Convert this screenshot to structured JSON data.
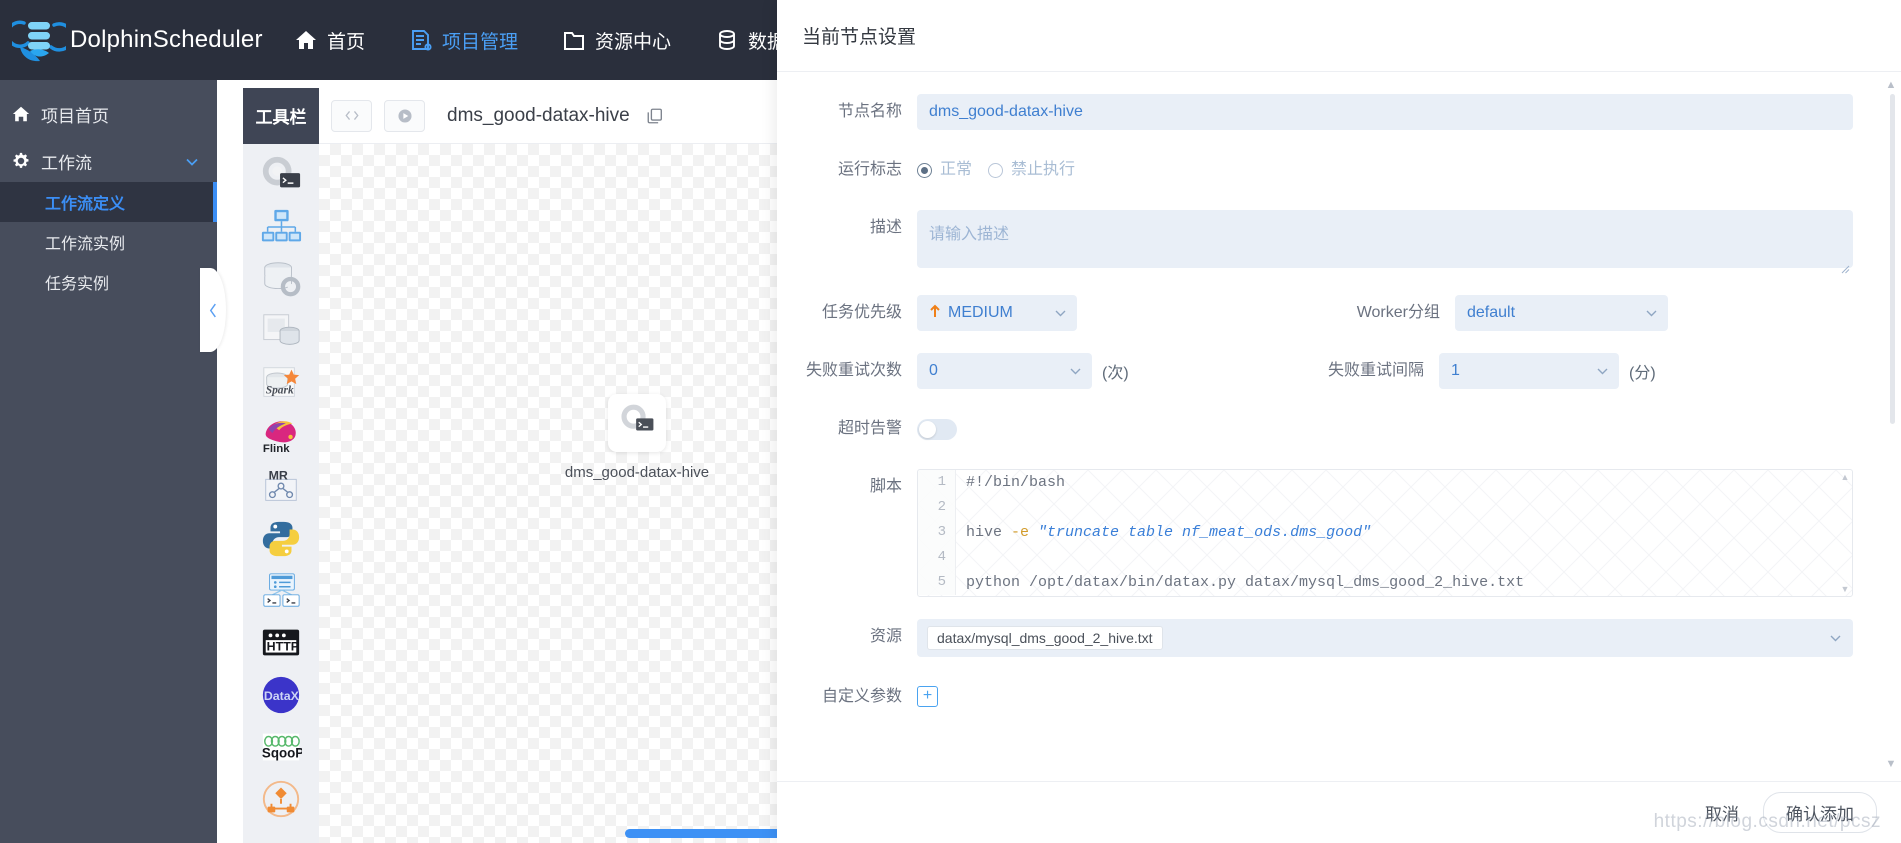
{
  "topnav": {
    "brand": "DolphinScheduler",
    "items": [
      {
        "label": "首页",
        "icon": "home-icon",
        "active": false
      },
      {
        "label": "项目管理",
        "icon": "project-icon",
        "active": true
      },
      {
        "label": "资源中心",
        "icon": "folder-icon",
        "active": false
      },
      {
        "label": "数据源中心",
        "icon": "database-icon",
        "active": false
      }
    ]
  },
  "sidebar": {
    "items": [
      {
        "label": "项目首页",
        "icon": "home-icon"
      },
      {
        "label": "工作流",
        "icon": "gear-icon"
      }
    ],
    "sub_items": [
      {
        "label": "工作流定义",
        "active": true
      },
      {
        "label": "工作流实例",
        "active": false
      },
      {
        "label": "任务实例",
        "active": false
      }
    ]
  },
  "dag": {
    "toolbar_tab": "工具栏",
    "title": "dms_good-datax-hive",
    "node": {
      "label": "dms_good-datax-hive",
      "icon": "shell-task-icon"
    },
    "palette": [
      "shell-task-icon",
      "sub-process-icon",
      "procedure-icon",
      "sql-icon",
      "spark-icon",
      "flink-icon",
      "mr-icon",
      "python-icon",
      "dependent-icon",
      "http-icon",
      "datax-icon",
      "sqoop-icon",
      "conditions-icon"
    ]
  },
  "panel": {
    "title": "当前节点设置",
    "node_name": {
      "label": "节点名称",
      "value": "dms_good-datax-hive"
    },
    "run_flag": {
      "label": "运行标志",
      "options": [
        {
          "label": "正常",
          "selected": true
        },
        {
          "label": "禁止执行",
          "selected": false
        }
      ]
    },
    "description": {
      "label": "描述",
      "value": "",
      "placeholder": "请输入描述"
    },
    "priority": {
      "label": "任务优先级",
      "value": "MEDIUM",
      "arrow": "up-arrow-icon"
    },
    "worker_group": {
      "label": "Worker分组",
      "value": "default"
    },
    "retry_times": {
      "label": "失败重试次数",
      "value": "0",
      "unit": "(次)"
    },
    "retry_interval": {
      "label": "失败重试间隔",
      "value": "1",
      "unit": "(分)"
    },
    "timeout_alarm": {
      "label": "超时告警",
      "enabled": false
    },
    "script": {
      "label": "脚本",
      "lines": [
        {
          "no": "1",
          "plain": "#!/bin/bash"
        },
        {
          "no": "2",
          "plain": ""
        },
        {
          "no": "3",
          "pre": "hive ",
          "flag": "-e ",
          "str": "\"truncate table nf_meat_ods.dms_good\""
        },
        {
          "no": "4",
          "plain": ""
        },
        {
          "no": "5",
          "plain": "python /opt/datax/bin/datax.py datax/mysql_dms_good_2_hive.txt"
        }
      ]
    },
    "resource": {
      "label": "资源",
      "tags": [
        "datax/mysql_dms_good_2_hive.txt"
      ]
    },
    "custom_params": {
      "label": "自定义参数",
      "add": "+"
    },
    "footer": {
      "cancel": "取消",
      "confirm": "确认添加"
    },
    "watermark": "https://blog.csdn.net/pcsz"
  },
  "colors": {
    "nav_bg": "#2a2f3c",
    "sidebar_bg": "#474d5c",
    "accent": "#3b8ef5",
    "input_bg": "#e9eff7",
    "priority_arrow": "#ef8019"
  }
}
